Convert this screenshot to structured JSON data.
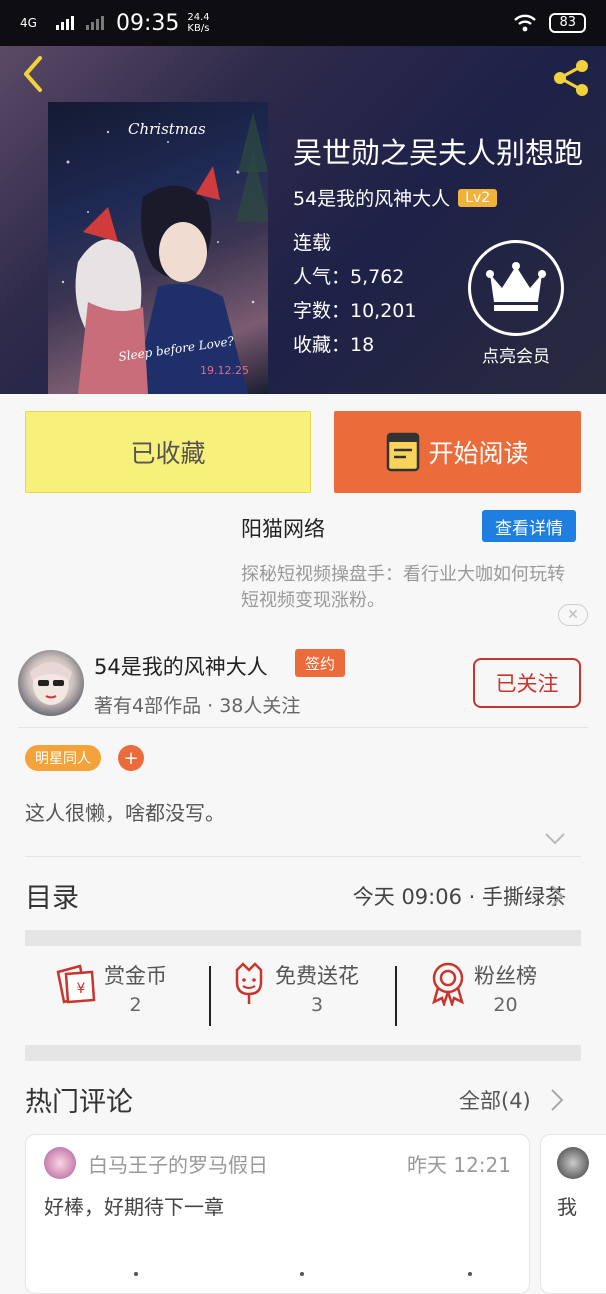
{
  "status": {
    "network": "4G",
    "time": "09:35",
    "speed_value": "24.4",
    "speed_unit": "KB/s",
    "battery": "83"
  },
  "book": {
    "title": "吴世勋之吴夫人别想跑",
    "author": "54是我的风神大人",
    "level": "Lv2",
    "state": "连载",
    "popularity": "人气：5,762",
    "word_count": "字数：10,201",
    "favorites": "收藏：18",
    "member_label": "点亮会员"
  },
  "cover": {
    "text_top": "Christmas",
    "text_mid": "Sleep before Love?",
    "date": "19.12.25"
  },
  "actions": {
    "collected": "已收藏",
    "read": "开始阅读"
  },
  "ad": {
    "name": "阳猫网络",
    "detail_button": "查看详情",
    "description": "探秘短视频操盘手：看行业大咖如何玩转短视频变现涨粉。",
    "close": "✕"
  },
  "author_block": {
    "name": "54是我的风神大人",
    "sign_badge": "签约",
    "stats": "著有4部作品 · 38人关注",
    "follow_button": "已关注",
    "tag": "明星同人",
    "tag_add": "+",
    "bio": "这人很懒，啥都没写。"
  },
  "toc": {
    "label": "目录",
    "latest": "今天 09:06 · 手撕绿茶"
  },
  "stats": [
    {
      "label": "赏金币",
      "value": "2",
      "icon": "reward-coin-icon"
    },
    {
      "label": "免费送花",
      "value": "3",
      "icon": "flower-icon"
    },
    {
      "label": "粉丝榜",
      "value": "20",
      "icon": "medal-icon"
    }
  ],
  "comments": {
    "label": "热门评论",
    "all": "全部(4)",
    "items": [
      {
        "user": "白马王子的罗马假日",
        "time": "昨天 12:21",
        "text": "好棒，好期待下一章"
      },
      {
        "user": "",
        "time": "",
        "text": "我"
      }
    ]
  },
  "colors": {
    "accent_orange": "#ec6b3b",
    "collected_yellow": "#f7f07a",
    "follow_red": "#c9352c",
    "ad_blue": "#1f7fe0",
    "tag_orange": "#f3a33a"
  }
}
